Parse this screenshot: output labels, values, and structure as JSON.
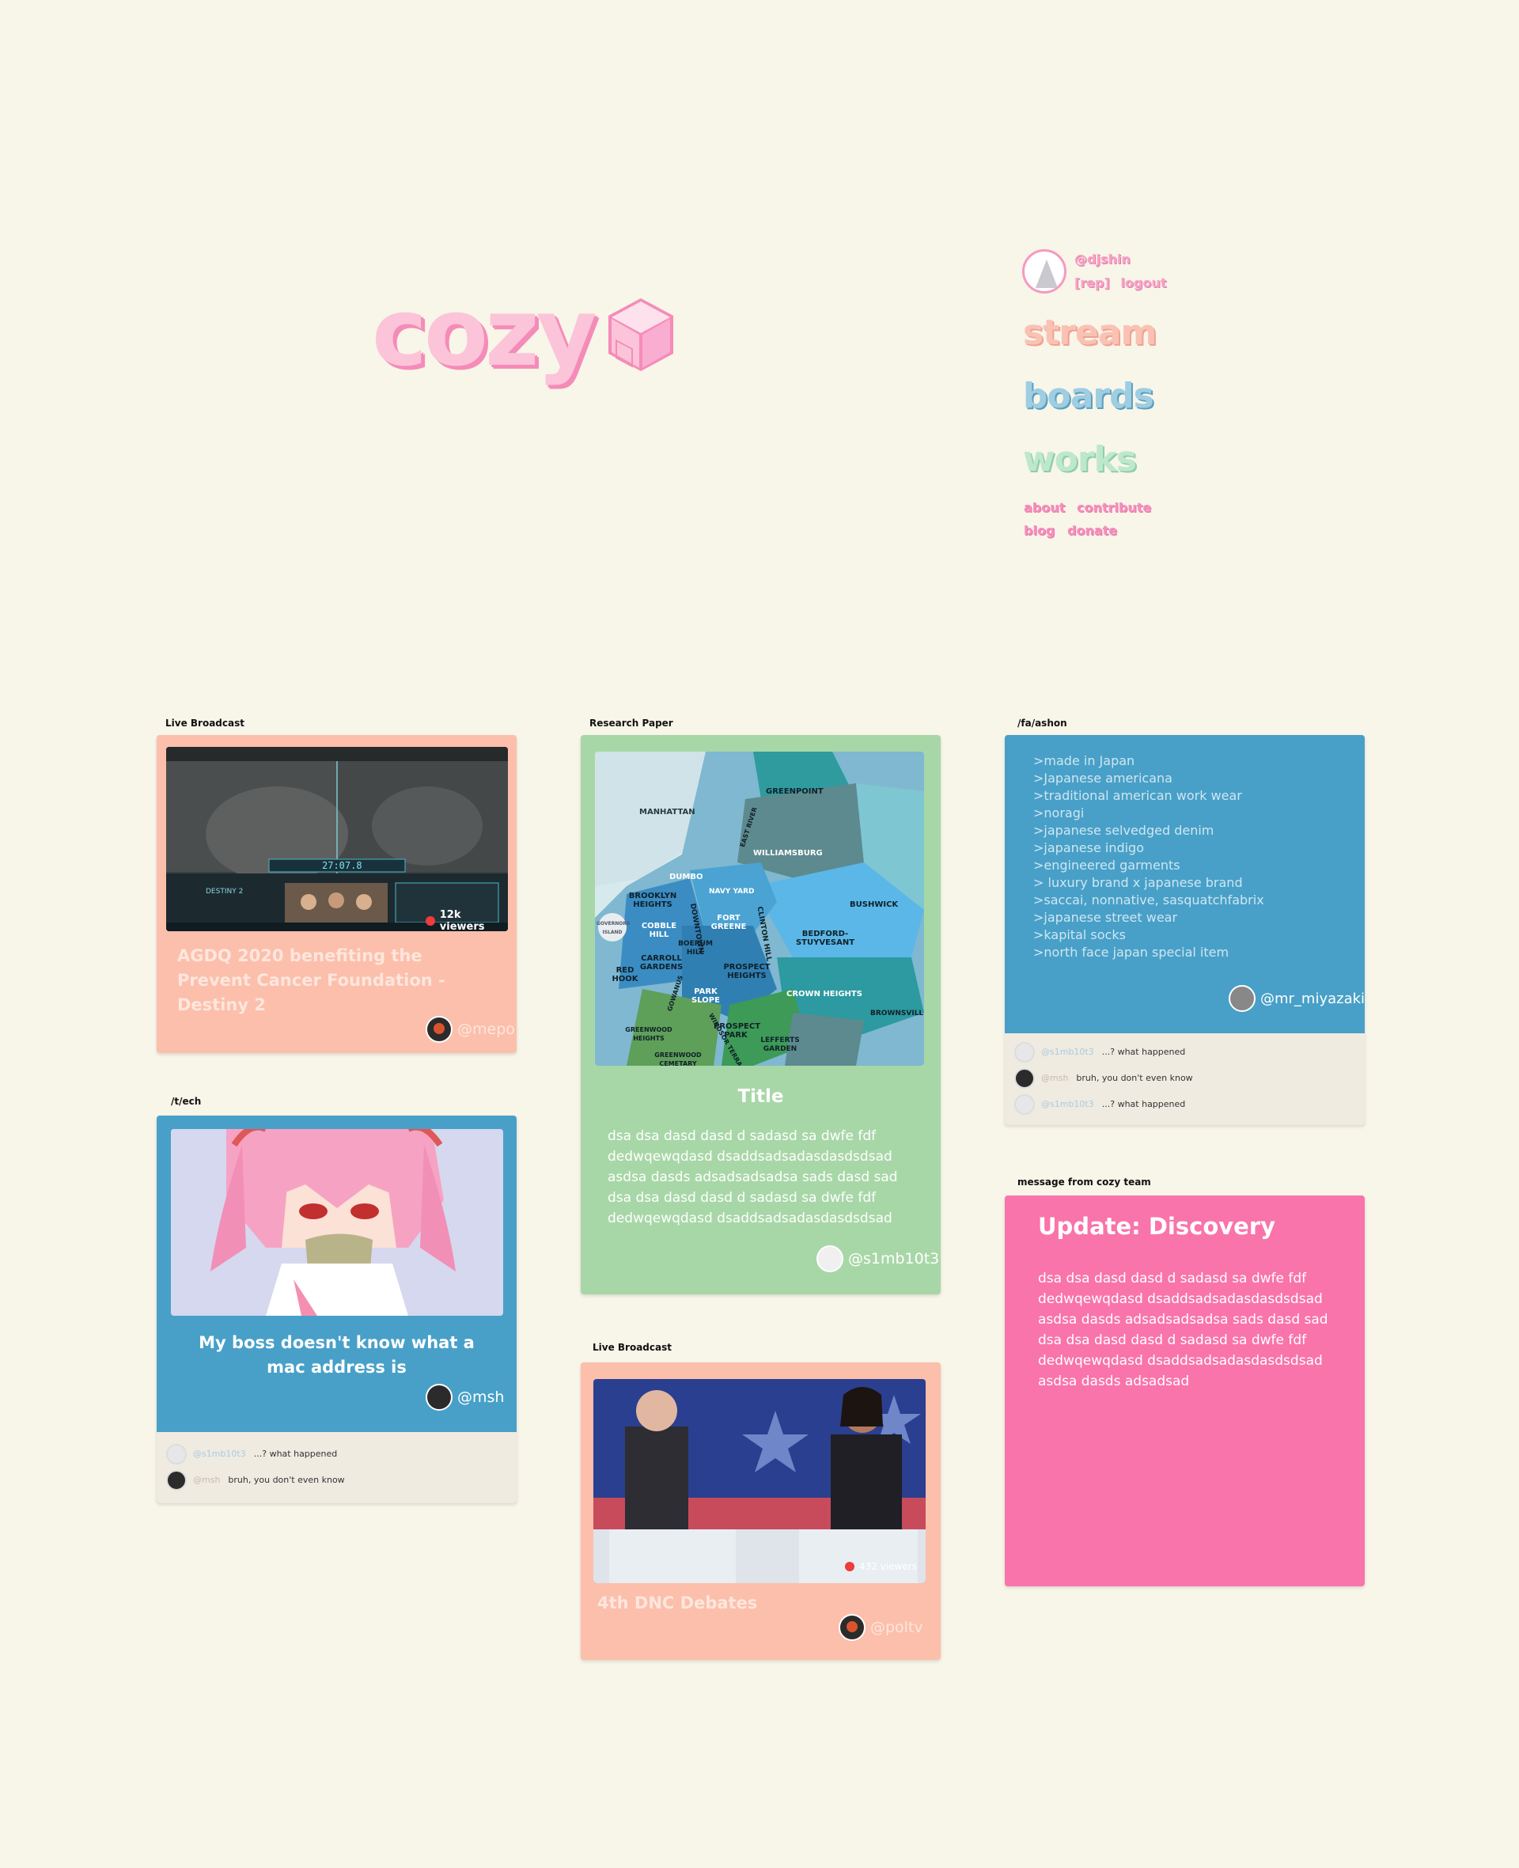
{
  "logo": {
    "text": "cozy"
  },
  "user": {
    "handle": "@djshin",
    "rep_label": "[rep]",
    "logout_label": "logout"
  },
  "nav": {
    "stream": "stream",
    "boards": "boards",
    "works": "works",
    "about": "about",
    "contribute": "contribute",
    "blog": "blog",
    "donate": "donate"
  },
  "colors": {
    "background": "#f8f5e9",
    "peach": "#fcbfab",
    "blue": "#48a0c8",
    "green": "#a8d7a7",
    "pink": "#f974ab"
  },
  "cards": {
    "agdq": {
      "label": "Live Broadcast",
      "title": "AGDQ 2020 benefiting the Prevent Cancer Foundation - Destiny 2",
      "viewers": "12k viewers",
      "author": "@mepo",
      "hud_timer": "27:07.8",
      "game_label": "DESTINY 2"
    },
    "tech": {
      "label": "/t/ech",
      "title": "My boss doesn't know what a mac address is",
      "author": "@msh",
      "comments": [
        {
          "user": "@s1mb10t3",
          "text": "...? what happened"
        },
        {
          "user": "@msh",
          "text": "bruh, you don't even know"
        }
      ]
    },
    "research": {
      "label": "Research Paper",
      "title": "Title",
      "body": "dsa dsa  dasd  dasd d sadasd sa dwfe fdf dedwqewqdasd dsaddsadsadasdasdsdsad asdsa dasds adsadsadsadsa sads dasd sad dsa dsa  dasd dasd d sadasd sa dwfe fdf dedwqewqdasd dsaddsadsadasdasdsdsad",
      "author": "@s1mb10t3",
      "map_labels": [
        "MANHATTAN",
        "GREENPOINT",
        "EAST RIVER",
        "WILLIAMSBURG",
        "DUMBO",
        "NAVY YARD",
        "BROOKLYN HEIGHTS",
        "DOWNTOWN",
        "FORT GREENE",
        "CLINTON HILL",
        "BUSHWICK",
        "COBBLE HILL",
        "BOERUM HILL",
        "BEDFORD-STUYVESANT",
        "CARROLL GARDENS",
        "RED HOOK",
        "PROSPECT HEIGHTS",
        "PARK SLOPE",
        "GOWANUS",
        "CROWN HEIGHTS",
        "BROWNSVILLE",
        "GREENWOOD HEIGHTS",
        "PROSPECT PARK",
        "WINDSOR TERRACE",
        "LEFFERTS GARDEN",
        "GREENWOOD CEMETARY",
        "GOVERNORS ISLAND"
      ]
    },
    "dnc": {
      "label": "Live Broadcast",
      "title": "4th DNC Debates",
      "viewers": "432 viewers",
      "author": "@poltv"
    },
    "fashion": {
      "label": "/fa/ashon",
      "lines": [
        ">made in Japan",
        ">Japanese americana",
        ">traditional american work wear",
        ">noragi",
        ">japanese selvedged denim",
        ">japanese indigo",
        ">engineered garments",
        "> luxury brand x japanese brand",
        ">saccai, nonnative, sasquatchfabrix",
        ">japanese street wear",
        ">kapital socks",
        ">north face japan special item"
      ],
      "author": "@mr_miyazaki",
      "comments": [
        {
          "user": "@s1mb10t3",
          "text": "...? what happened"
        },
        {
          "user": "@msh",
          "text": "bruh, you don't even know"
        },
        {
          "user": "@s1mb10t3",
          "text": "...? what happened"
        }
      ]
    },
    "update": {
      "label": "message from cozy team",
      "title": "Update: Discovery",
      "body": "dsa dsa  dasd  dasd d sadasd sa dwfe fdf dedwqewqdasd dsaddsadsadasdasdsdsad asdsa dasds adsadsadsadsa sads dasd sad dsa dsa  dasd  dasd d sadasd sa dwfe fdf dedwqewqdasd dsaddsadsadasdasdsdsad asdsa dasds adsadsad"
    }
  }
}
